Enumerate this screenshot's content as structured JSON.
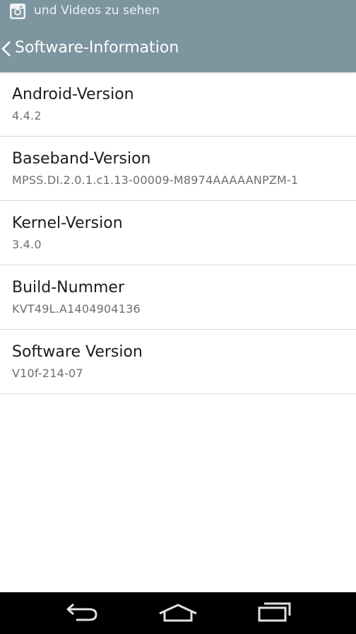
{
  "status_bar": {
    "notification_text": "und Videos zu sehen",
    "notification_icon": "instagram-icon"
  },
  "action_bar": {
    "back_icon": "chevron-left-icon",
    "title": "Software-Information"
  },
  "items": [
    {
      "title": "Android-Version",
      "value": "4.4.2"
    },
    {
      "title": "Baseband-Version",
      "value": "MPSS.DI.2.0.1.c1.13-00009-M8974AAAAANPZM-1"
    },
    {
      "title": "Kernel-Version",
      "value": "3.4.0"
    },
    {
      "title": "Build-Nummer",
      "value": "KVT49L.A1404904136"
    },
    {
      "title": "Software Version",
      "value": "V10f-214-07"
    }
  ],
  "navigation_bar": {
    "back_icon": "back-arrow-icon",
    "home_icon": "home-icon",
    "recent_apps_icon": "recent-apps-icon"
  },
  "colors": {
    "action_bar": "#7d959f",
    "navigation_bar": "#000000",
    "background": "#ffffff",
    "divider": "#dadada"
  }
}
